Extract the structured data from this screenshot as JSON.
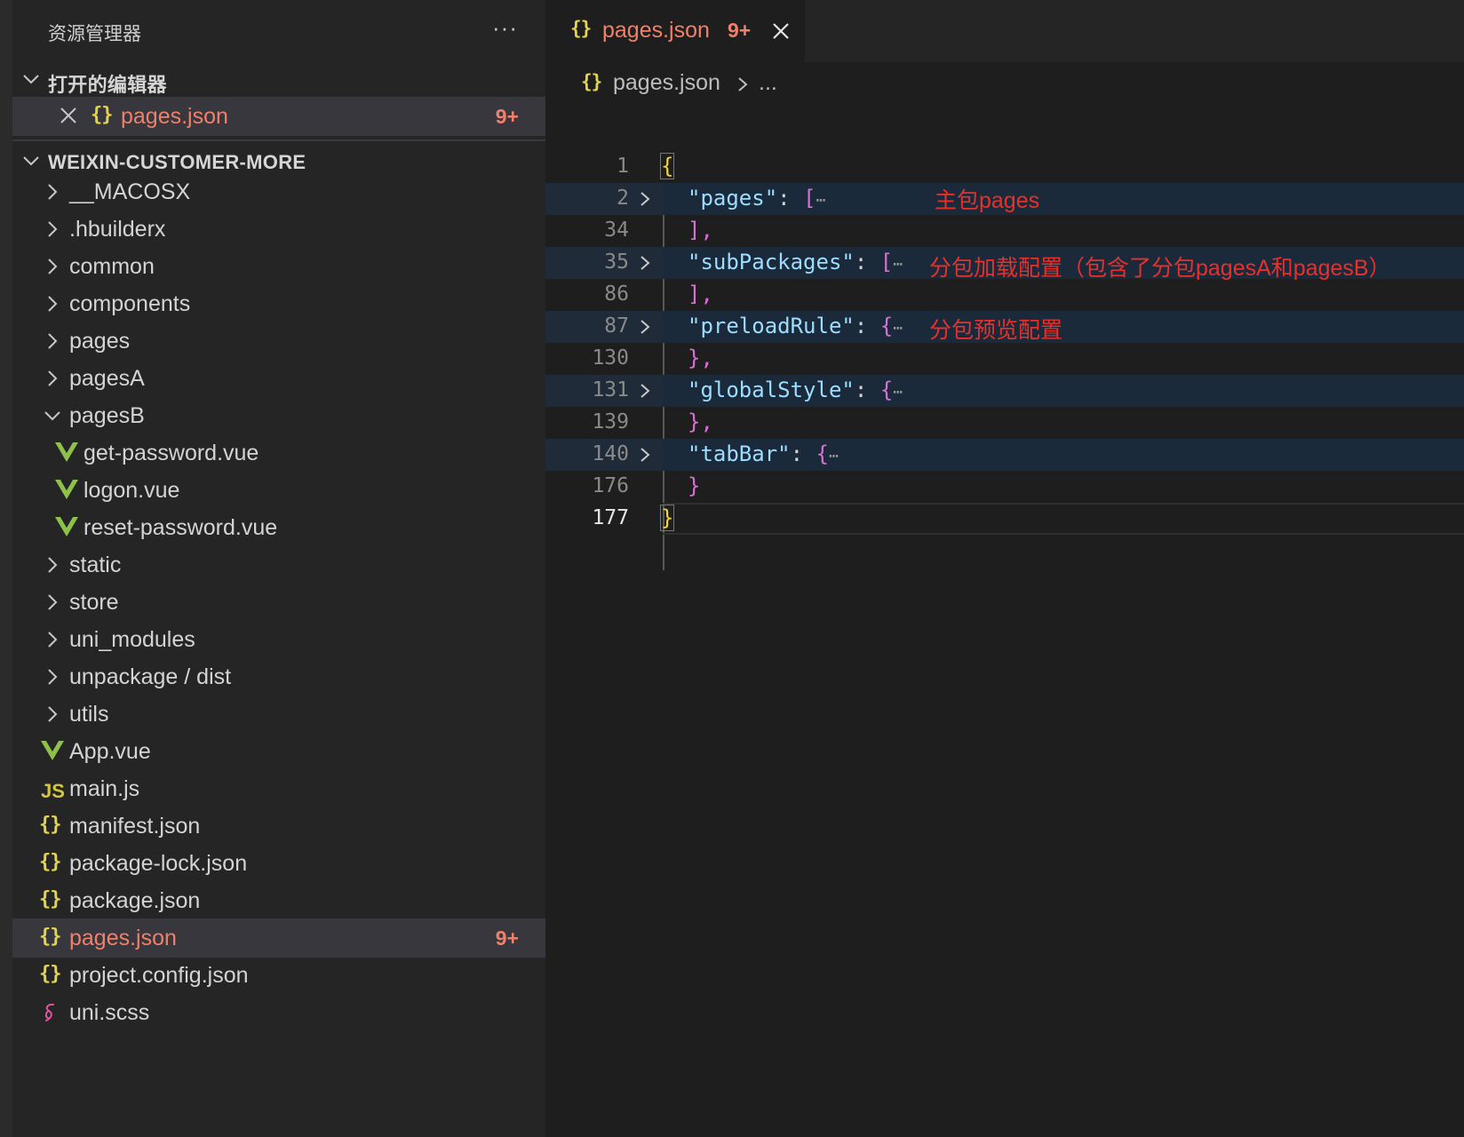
{
  "sidebar": {
    "title": "资源管理器",
    "more": "···",
    "open_editors": {
      "label": "打开的编辑器",
      "items": [
        {
          "icon": "{}",
          "name": "pages.json",
          "badge": "9+"
        }
      ]
    },
    "project": {
      "label": "WEIXIN-CUSTOMER-MORE",
      "folders": [
        {
          "name": "__MACOSX"
        },
        {
          "name": ".hbuilderx"
        },
        {
          "name": "common"
        },
        {
          "name": "components"
        },
        {
          "name": "pages"
        },
        {
          "name": "pagesA"
        },
        {
          "name": "pagesB"
        }
      ],
      "pagesB_children": [
        {
          "name": "get-password.vue"
        },
        {
          "name": "logon.vue"
        },
        {
          "name": "reset-password.vue"
        }
      ],
      "folders2": [
        {
          "name": "static"
        },
        {
          "name": "store"
        },
        {
          "name": "uni_modules"
        },
        {
          "name": "unpackage / dist"
        },
        {
          "name": "utils"
        }
      ],
      "files": [
        {
          "name": "App.vue",
          "icon": "vue"
        },
        {
          "name": "main.js",
          "icon": "JS"
        },
        {
          "name": "manifest.json",
          "icon": "{}"
        },
        {
          "name": "package-lock.json",
          "icon": "{}"
        },
        {
          "name": "package.json",
          "icon": "{}"
        },
        {
          "name": "pages.json",
          "icon": "{}",
          "badge": "9+"
        },
        {
          "name": "project.config.json",
          "icon": "{}"
        },
        {
          "name": "uni.scss",
          "icon": "scss"
        }
      ]
    }
  },
  "tab": {
    "icon": "{}",
    "name": "pages.json",
    "badge": "9+"
  },
  "breadcrumb": {
    "icon": "{}",
    "file": "pages.json",
    "more": "..."
  },
  "editor": {
    "lines": [
      {
        "no": "1"
      },
      {
        "no": "2",
        "key": "\"pages\"",
        "open": "[",
        "note": "主包pages"
      },
      {
        "no": "34",
        "close": "],"
      },
      {
        "no": "35",
        "key": "\"subPackages\"",
        "open": "[",
        "note": "分包加载配置（包含了分包pagesA和pagesB）"
      },
      {
        "no": "86",
        "close": "],"
      },
      {
        "no": "87",
        "key": "\"preloadRule\"",
        "open": "{",
        "note": "分包预览配置"
      },
      {
        "no": "130",
        "close": "},"
      },
      {
        "no": "131",
        "key": "\"globalStyle\"",
        "open": "{"
      },
      {
        "no": "139",
        "close": "},"
      },
      {
        "no": "140",
        "key": "\"tabBar\"",
        "open": "{"
      },
      {
        "no": "176",
        "close": "}"
      },
      {
        "no": "177"
      }
    ],
    "brace_open": "{",
    "brace_close": "}",
    "colon": ":",
    "ellipsis": "⋯"
  },
  "colors": {
    "modified": "#f0806a",
    "json_icon": "#e3d44d",
    "vue_icon": "#8dc149",
    "annotation": "#e8302a"
  }
}
